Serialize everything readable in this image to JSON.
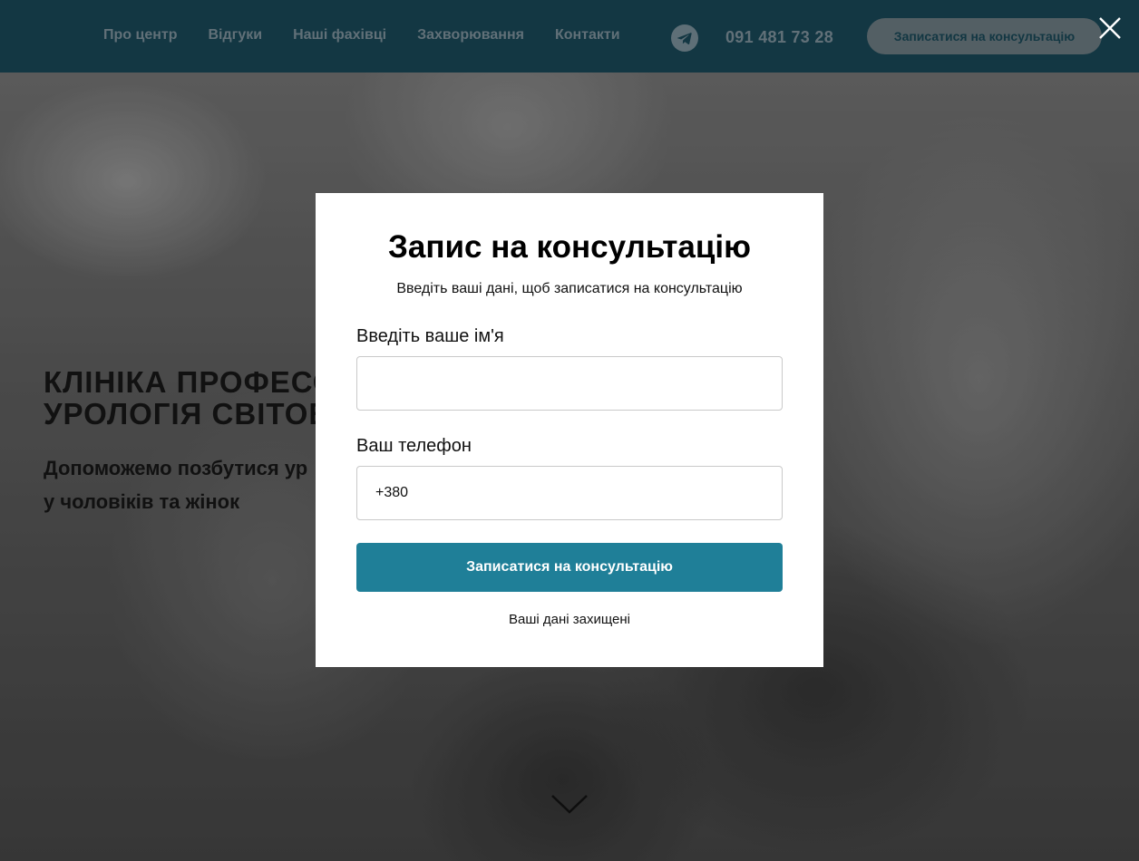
{
  "header": {
    "nav": [
      {
        "label": "Про центр"
      },
      {
        "label": "Відгуки"
      },
      {
        "label": "Наші фахівці"
      },
      {
        "label": "Захворювання"
      },
      {
        "label": "Контакти"
      }
    ],
    "telegram_icon": "telegram-icon",
    "phone": "091 481 73 28",
    "cta_label": "Записатися на консультацію",
    "bg_color": "#163f4d"
  },
  "hero": {
    "title_line1": "КЛІНІКА ПРОФЕСО",
    "title_line2": "УРОЛОГІЯ СВІТОВ",
    "subtitle_line1": "Допоможемо позбутися ур",
    "subtitle_line2": "у чоловіків та жінок",
    "scroll_icon": "chevron-down-icon"
  },
  "modal": {
    "title": "Запис на консультацію",
    "subtitle": "Введіть ваші дані, щоб записатися на консультацію",
    "name_label": "Введіть ваше ім'я",
    "name_value": "",
    "phone_label": "Ваш телефон",
    "phone_value": "+380",
    "submit_label": "Записатися на консультацію",
    "privacy_note": "Ваші дані захищені",
    "accent_color": "#1f7f98",
    "close_icon": "close-icon"
  }
}
